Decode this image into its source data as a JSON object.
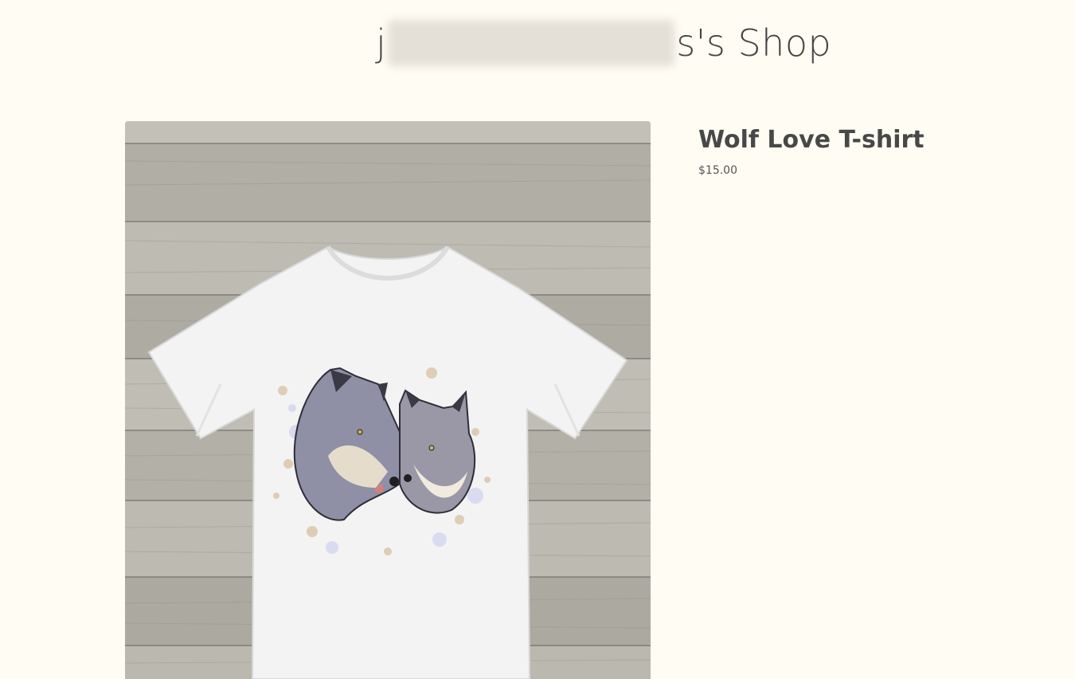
{
  "shop": {
    "title_prefix": "j",
    "title_suffix": "s's Shop"
  },
  "product": {
    "name": "Wolf Love T-shirt",
    "price": "$15.00",
    "image_subject": "white t-shirt with wolf pair illustration on wood background"
  },
  "colors": {
    "page_background": "#fffcf3",
    "text": "#484848",
    "wood_base": "#b9b6ae",
    "shirt": "#f2f2f2"
  }
}
